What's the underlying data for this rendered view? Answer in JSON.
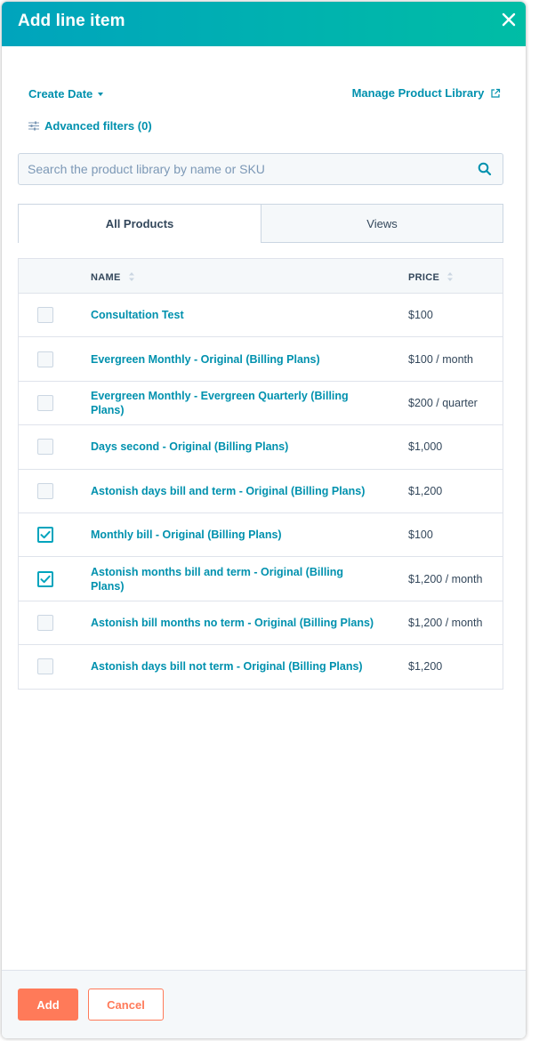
{
  "modal": {
    "title": "Add line item",
    "close_icon": "close-icon"
  },
  "filters": {
    "create_date_label": "Create Date",
    "manage_library_label": "Manage Product Library",
    "advanced_filters_label": "Advanced filters (0)"
  },
  "search": {
    "placeholder": "Search the product library by name or SKU",
    "value": "",
    "icon": "search-icon"
  },
  "tabs": [
    {
      "label": "All Products",
      "active": true
    },
    {
      "label": "Views",
      "active": false
    }
  ],
  "table": {
    "columns": [
      "NAME",
      "PRICE"
    ],
    "rows": [
      {
        "name": "Consultation Test",
        "price": "$100",
        "checked": false
      },
      {
        "name": "Evergreen Monthly - Original (Billing Plans)",
        "price": "$100 / month",
        "checked": false
      },
      {
        "name": "Evergreen Monthly - Evergreen Quarterly (Billing Plans)",
        "price": "$200 / quarter",
        "checked": false
      },
      {
        "name": "Days second - Original (Billing Plans)",
        "price": "$1,000",
        "checked": false
      },
      {
        "name": "Astonish days bill and term - Original (Billing Plans)",
        "price": "$1,200",
        "checked": false
      },
      {
        "name": "Monthly bill - Original (Billing Plans)",
        "price": "$100",
        "checked": true
      },
      {
        "name": "Astonish months bill and term - Original (Billing Plans)",
        "price": "$1,200 / month",
        "checked": true
      },
      {
        "name": "Astonish bill months no term - Original (Billing Plans)",
        "price": "$1,200 / month",
        "checked": false
      },
      {
        "name": "Astonish days bill not term - Original (Billing Plans)",
        "price": "$1,200",
        "checked": false
      }
    ]
  },
  "footer": {
    "add_label": "Add",
    "cancel_label": "Cancel"
  },
  "colors": {
    "header_gradient_start": "#00a4bd",
    "header_gradient_end": "#00bda5",
    "link": "#0091ae",
    "primary_button": "#ff7a59",
    "checkbox_checked": "#00a4bd"
  }
}
